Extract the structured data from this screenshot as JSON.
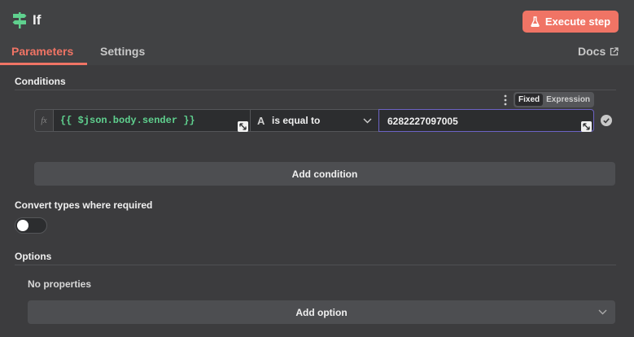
{
  "node": {
    "title": "If",
    "icon": "signpost-icon",
    "accent_color": "#5fd08e"
  },
  "header": {
    "execute_label": "Execute step",
    "execute_icon": "flask-icon",
    "execute_color": "#f07465"
  },
  "tabs": [
    {
      "label": "Parameters",
      "active": true
    },
    {
      "label": "Settings",
      "active": false
    }
  ],
  "docs": {
    "label": "Docs",
    "icon": "external-link-icon"
  },
  "conditions": {
    "title": "Conditions",
    "mode_options": {
      "fixed": "Fixed",
      "expression": "Expression",
      "selected": "Fixed"
    },
    "rows": [
      {
        "fx_label": "fx",
        "left_value": "{{ $json.body.sender }}",
        "operator_type_icon": "string-type-icon",
        "operator_type_glyph": "A",
        "operator": "is equal to",
        "right_value": "6282227097005"
      }
    ],
    "add_label": "Add condition"
  },
  "convert_types": {
    "label": "Convert types where required",
    "enabled": false
  },
  "options": {
    "title": "Options",
    "empty_text": "No properties",
    "add_label": "Add option"
  }
}
